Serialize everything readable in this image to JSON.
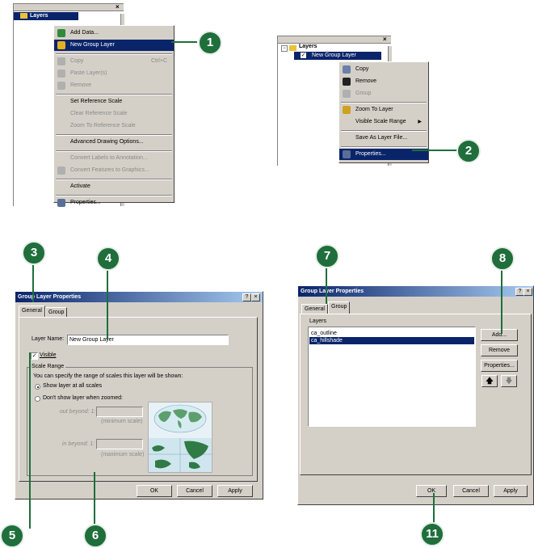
{
  "panel1": {
    "toc_root": "Layers",
    "menu": [
      {
        "label": "Add Data...",
        "icon": "add-data-icon"
      },
      {
        "label": "New Group Layer",
        "icon": "new-group-layer-icon",
        "selected": true
      },
      {
        "label": "Copy",
        "icon": "copy-icon",
        "disabled": true,
        "shortcut": "Ctrl+C"
      },
      {
        "label": "Paste Layer(s)",
        "icon": "paste-icon",
        "disabled": true
      },
      {
        "label": "Remove",
        "icon": "remove-icon",
        "disabled": true
      },
      {
        "label": "Set Reference Scale"
      },
      {
        "label": "Clear Reference Scale",
        "disabled": true
      },
      {
        "label": "Zoom To Reference Scale",
        "disabled": true
      },
      {
        "label": "Advanced Drawing Options..."
      },
      {
        "label": "Convert Labels to Annotation...",
        "disabled": true
      },
      {
        "label": "Convert Features to Graphics...",
        "icon": "convert-features-icon",
        "disabled": true
      },
      {
        "label": "Activate"
      },
      {
        "label": "Properties...",
        "icon": "properties-icon"
      }
    ]
  },
  "panel2": {
    "toc_root": "Layers",
    "toc_child": "New Group Layer",
    "menu": [
      {
        "label": "Copy",
        "icon": "copy-icon"
      },
      {
        "label": "Remove",
        "icon": "remove-icon"
      },
      {
        "label": "Group",
        "icon": "group-icon",
        "disabled": true
      },
      {
        "label": "Zoom To Layer",
        "icon": "zoom-to-layer-icon"
      },
      {
        "label": "Visible Scale Range",
        "submenu": true
      },
      {
        "label": "Save As Layer File..."
      },
      {
        "label": "Properties...",
        "icon": "properties-icon",
        "selected": true
      }
    ]
  },
  "dialog_general": {
    "title": "Group Layer Properties",
    "help_button": "?",
    "close_button": "×",
    "tabs": [
      "General",
      "Group"
    ],
    "layer_name_label": "Layer Name:",
    "layer_name_value": "New Group Layer",
    "visible_label": "Visible",
    "scale_range_label": "Scale Range",
    "scale_description": "You can specify the range of scales this layer will be shown:",
    "show_all_scales": "Show layer at all scales",
    "dont_show": "Don't show layer when zoomed:",
    "out_beyond": "out beyond: 1:",
    "out_hint": "(minimum scale)",
    "in_beyond": "in beyond: 1:",
    "in_hint": "(maximum scale)",
    "ok": "OK",
    "cancel": "Cancel",
    "apply": "Apply"
  },
  "dialog_group": {
    "title": "Group Layer Properties",
    "help_button": "?",
    "close_button": "×",
    "tabs": [
      "General",
      "Group"
    ],
    "layers_label": "Layers",
    "layers": [
      "ca_outline",
      "ca_hillshade"
    ],
    "add": "Add...",
    "remove": "Remove",
    "properties": "Properties...",
    "ok": "OK",
    "cancel": "Cancel",
    "apply": "Apply"
  },
  "callouts": [
    "1",
    "2",
    "3",
    "4",
    "5",
    "6",
    "7",
    "8",
    "11"
  ],
  "colors": {
    "callout": "#1f6e3c",
    "selection": "#0a246a",
    "dialog_face": "#d4d0c8"
  }
}
